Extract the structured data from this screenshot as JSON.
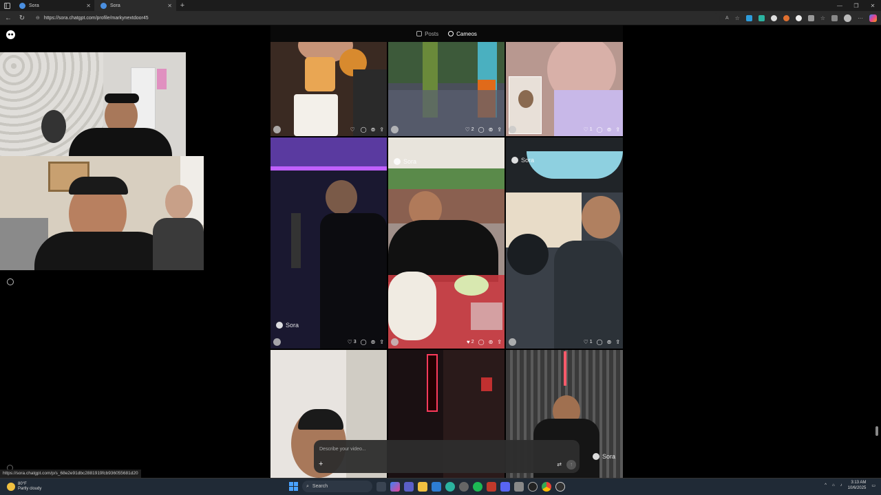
{
  "browser": {
    "tabs": [
      {
        "label": "Sora",
        "active": false
      },
      {
        "label": "Sora",
        "active": true
      }
    ],
    "url": "https://sora.chatgpt.com/profile/markynextdoor45",
    "status_url": "https://sora.chatgpt.com/p/s_68e2e91dbc2881919fcb936055681d20"
  },
  "page": {
    "header_tabs": [
      {
        "label": "Posts",
        "icon": "play-square-icon",
        "active": false
      },
      {
        "label": "Cameos",
        "icon": "cameo-icon",
        "active": true
      }
    ],
    "watermark": "Sora",
    "tiles": [
      {
        "likes": "",
        "liked": false
      },
      {
        "likes": "2",
        "liked": false
      },
      {
        "likes": "1",
        "liked": false
      },
      {
        "likes": "3",
        "liked": false
      },
      {
        "likes": "2",
        "liked": true
      },
      {
        "likes": "1",
        "liked": false
      }
    ],
    "composer": {
      "placeholder": "Describe your video...",
      "add_icon": "+",
      "send_icon": "↑"
    }
  },
  "taskbar": {
    "weather_temp": "80°F",
    "weather_desc": "Partly cloudy",
    "search_placeholder": "Search",
    "time": "3:13 AM",
    "date": "10/6/2025"
  },
  "colors": {
    "background": "#000000",
    "tab_strip": "#1c1c1c",
    "taskbar": "#202a36",
    "accent_blue": "#4a8fe0"
  }
}
